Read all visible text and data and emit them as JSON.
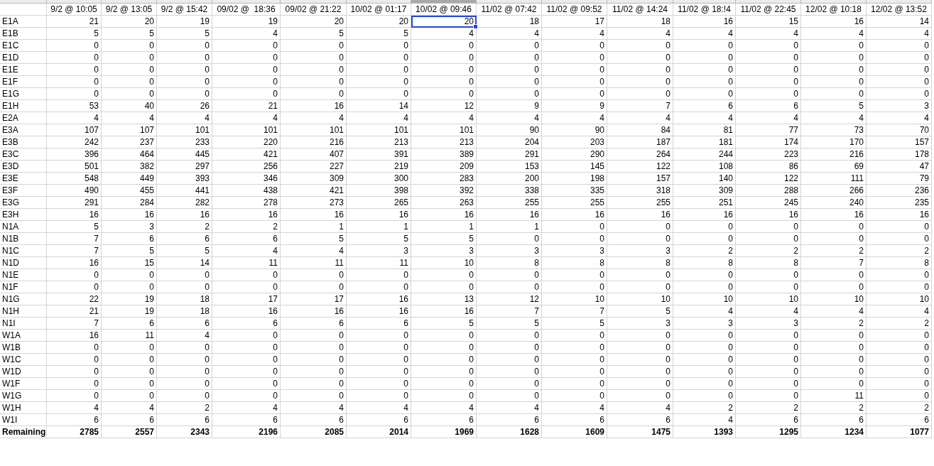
{
  "columns": [
    {
      "label": "9/2 @ 10:05",
      "selected": false
    },
    {
      "label": "9/2 @ 13:05",
      "selected": false
    },
    {
      "label": "9/2 @ 15:42",
      "selected": false
    },
    {
      "label": "09/02 @  18:36",
      "selected": false
    },
    {
      "label": "09/02 @ 21:22",
      "selected": false
    },
    {
      "label": "10/02 @ 01:17",
      "selected": false
    },
    {
      "label": "10/02 @ 09:46",
      "selected": true
    },
    {
      "label": "11/02 @ 07:42",
      "selected": false
    },
    {
      "label": "11/02 @ 09:52",
      "selected": false
    },
    {
      "label": "11/02 @ 14:24",
      "selected": false
    },
    {
      "label": "11/02 @ 18:!4",
      "selected": false
    },
    {
      "label": "11/02 @ 22:45",
      "selected": false
    },
    {
      "label": "12/02 @ 10:18",
      "selected": false
    },
    {
      "label": "12/02 @ 13:52",
      "selected": false
    }
  ],
  "rows": [
    {
      "label": "E1A",
      "selected": true,
      "kind": "data",
      "values": [
        "21",
        "20",
        "19",
        "19",
        "20",
        "20",
        "20",
        "18",
        "17",
        "18",
        "16",
        "15",
        "16",
        "14"
      ]
    },
    {
      "label": "E1B",
      "selected": false,
      "kind": "data",
      "values": [
        "5",
        "5",
        "5",
        "4",
        "5",
        "5",
        "4",
        "4",
        "4",
        "4",
        "4",
        "4",
        "4",
        "4"
      ]
    },
    {
      "label": "E1C",
      "selected": false,
      "kind": "data",
      "values": [
        "0",
        "0",
        "0",
        "0",
        "0",
        "0",
        "0",
        "0",
        "0",
        "0",
        "0",
        "0",
        "0",
        "0"
      ]
    },
    {
      "label": "E1D",
      "selected": false,
      "kind": "data",
      "values": [
        "0",
        "0",
        "0",
        "0",
        "0",
        "0",
        "0",
        "0",
        "0",
        "0",
        "0",
        "0",
        "0",
        "0"
      ]
    },
    {
      "label": "E1E",
      "selected": false,
      "kind": "data",
      "values": [
        "0",
        "0",
        "0",
        "0",
        "0",
        "0",
        "0",
        "0",
        "0",
        "0",
        "0",
        "0",
        "0",
        "0"
      ]
    },
    {
      "label": "E1F",
      "selected": false,
      "kind": "data",
      "values": [
        "0",
        "0",
        "0",
        "0",
        "0",
        "0",
        "0",
        "0",
        "0",
        "0",
        "0",
        "0",
        "0",
        "0"
      ]
    },
    {
      "label": "E1G",
      "selected": false,
      "kind": "data",
      "values": [
        "0",
        "0",
        "0",
        "0",
        "0",
        "0",
        "0",
        "0",
        "0",
        "0",
        "0",
        "0",
        "0",
        "0"
      ]
    },
    {
      "label": "E1H",
      "selected": false,
      "kind": "data",
      "values": [
        "53",
        "40",
        "26",
        "21",
        "16",
        "14",
        "12",
        "9",
        "9",
        "7",
        "6",
        "6",
        "5",
        "3"
      ]
    },
    {
      "label": "E2A",
      "selected": false,
      "kind": "data",
      "values": [
        "4",
        "4",
        "4",
        "4",
        "4",
        "4",
        "4",
        "4",
        "4",
        "4",
        "4",
        "4",
        "4",
        "4"
      ]
    },
    {
      "label": "E3A",
      "selected": false,
      "kind": "data",
      "values": [
        "107",
        "107",
        "101",
        "101",
        "101",
        "101",
        "101",
        "90",
        "90",
        "84",
        "81",
        "77",
        "73",
        "70"
      ]
    },
    {
      "label": "E3B",
      "selected": false,
      "kind": "data",
      "values": [
        "242",
        "237",
        "233",
        "220",
        "216",
        "213",
        "213",
        "204",
        "203",
        "187",
        "181",
        "174",
        "170",
        "157"
      ]
    },
    {
      "label": "E3C",
      "selected": false,
      "kind": "data",
      "values": [
        "396",
        "464",
        "445",
        "421",
        "407",
        "391",
        "389",
        "291",
        "290",
        "264",
        "244",
        "223",
        "216",
        "178"
      ]
    },
    {
      "label": "E3D",
      "selected": false,
      "kind": "data",
      "values": [
        "501",
        "382",
        "297",
        "256",
        "227",
        "219",
        "209",
        "153",
        "145",
        "122",
        "108",
        "86",
        "69",
        "47"
      ]
    },
    {
      "label": "E3E",
      "selected": false,
      "kind": "data",
      "values": [
        "548",
        "449",
        "393",
        "346",
        "309",
        "300",
        "283",
        "200",
        "198",
        "157",
        "140",
        "122",
        "111",
        "79"
      ]
    },
    {
      "label": "E3F",
      "selected": false,
      "kind": "data",
      "values": [
        "490",
        "455",
        "441",
        "438",
        "421",
        "398",
        "392",
        "338",
        "335",
        "318",
        "309",
        "288",
        "266",
        "236"
      ]
    },
    {
      "label": "E3G",
      "selected": false,
      "kind": "data",
      "values": [
        "291",
        "284",
        "282",
        "278",
        "273",
        "265",
        "263",
        "255",
        "255",
        "255",
        "251",
        "245",
        "240",
        "235"
      ]
    },
    {
      "label": "E3H",
      "selected": false,
      "kind": "data",
      "values": [
        "16",
        "16",
        "16",
        "16",
        "16",
        "16",
        "16",
        "16",
        "16",
        "16",
        "16",
        "16",
        "16",
        "16"
      ]
    },
    {
      "label": "N1A",
      "selected": false,
      "kind": "data",
      "values": [
        "5",
        "3",
        "2",
        "2",
        "1",
        "1",
        "1",
        "1",
        "0",
        "0",
        "0",
        "0",
        "0",
        "0"
      ]
    },
    {
      "label": "N1B",
      "selected": false,
      "kind": "data",
      "values": [
        "7",
        "6",
        "6",
        "6",
        "5",
        "5",
        "5",
        "0",
        "0",
        "0",
        "0",
        "0",
        "0",
        "0"
      ]
    },
    {
      "label": "N1C",
      "selected": false,
      "kind": "data",
      "values": [
        "7",
        "5",
        "5",
        "4",
        "4",
        "3",
        "3",
        "3",
        "3",
        "3",
        "2",
        "2",
        "2",
        "2"
      ]
    },
    {
      "label": "N1D",
      "selected": false,
      "kind": "data",
      "values": [
        "16",
        "15",
        "14",
        "11",
        "11",
        "11",
        "10",
        "8",
        "8",
        "8",
        "8",
        "8",
        "7",
        "8"
      ]
    },
    {
      "label": "N1E",
      "selected": false,
      "kind": "data",
      "values": [
        "0",
        "0",
        "0",
        "0",
        "0",
        "0",
        "0",
        "0",
        "0",
        "0",
        "0",
        "0",
        "0",
        "0"
      ]
    },
    {
      "label": "N1F",
      "selected": false,
      "kind": "data",
      "values": [
        "0",
        "0",
        "0",
        "0",
        "0",
        "0",
        "0",
        "0",
        "0",
        "0",
        "0",
        "0",
        "0",
        "0"
      ]
    },
    {
      "label": "N1G",
      "selected": false,
      "kind": "data",
      "values": [
        "22",
        "19",
        "18",
        "17",
        "17",
        "16",
        "13",
        "12",
        "10",
        "10",
        "10",
        "10",
        "10",
        "10"
      ]
    },
    {
      "label": "N1H",
      "selected": false,
      "kind": "data",
      "values": [
        "21",
        "19",
        "18",
        "16",
        "16",
        "16",
        "16",
        "7",
        "7",
        "5",
        "4",
        "4",
        "4",
        "4"
      ]
    },
    {
      "label": "N1I",
      "selected": false,
      "kind": "data",
      "values": [
        "7",
        "6",
        "6",
        "6",
        "6",
        "6",
        "5",
        "5",
        "5",
        "3",
        "3",
        "3",
        "2",
        "2"
      ]
    },
    {
      "label": "W1A",
      "selected": false,
      "kind": "data",
      "values": [
        "16",
        "11",
        "4",
        "0",
        "0",
        "0",
        "0",
        "0",
        "0",
        "0",
        "0",
        "0",
        "0",
        "0"
      ]
    },
    {
      "label": "W1B",
      "selected": false,
      "kind": "data",
      "values": [
        "0",
        "0",
        "0",
        "0",
        "0",
        "0",
        "0",
        "0",
        "0",
        "0",
        "0",
        "0",
        "0",
        "0"
      ]
    },
    {
      "label": "W1C",
      "selected": false,
      "kind": "data",
      "values": [
        "0",
        "0",
        "0",
        "0",
        "0",
        "0",
        "0",
        "0",
        "0",
        "0",
        "0",
        "0",
        "0",
        "0"
      ]
    },
    {
      "label": "W1D",
      "selected": false,
      "kind": "data",
      "values": [
        "0",
        "0",
        "0",
        "0",
        "0",
        "0",
        "0",
        "0",
        "0",
        "0",
        "0",
        "0",
        "0",
        "0"
      ]
    },
    {
      "label": "W1F",
      "selected": false,
      "kind": "data",
      "values": [
        "0",
        "0",
        "0",
        "0",
        "0",
        "0",
        "0",
        "0",
        "0",
        "0",
        "0",
        "0",
        "0",
        "0"
      ]
    },
    {
      "label": "W1G",
      "selected": false,
      "kind": "data",
      "values": [
        "0",
        "0",
        "0",
        "0",
        "0",
        "0",
        "0",
        "0",
        "0",
        "0",
        "0",
        "0",
        "11",
        "0"
      ]
    },
    {
      "label": "W1H",
      "selected": false,
      "kind": "data",
      "values": [
        "4",
        "4",
        "2",
        "4",
        "4",
        "4",
        "4",
        "4",
        "4",
        "4",
        "2",
        "2",
        "2",
        "2"
      ]
    },
    {
      "label": "W1I",
      "selected": false,
      "kind": "data",
      "values": [
        "6",
        "6",
        "6",
        "6",
        "6",
        "6",
        "6",
        "6",
        "6",
        "6",
        "4",
        "6",
        "6",
        "6"
      ]
    },
    {
      "label": "Remaining",
      "selected": false,
      "kind": "total",
      "values": [
        "2785",
        "2557",
        "2343",
        "2196",
        "2085",
        "2014",
        "1969",
        "1628",
        "1609",
        "1475",
        "1393",
        "1295",
        "1234",
        "1077"
      ]
    }
  ]
}
